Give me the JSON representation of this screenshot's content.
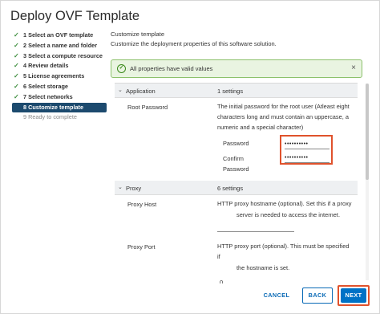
{
  "dialog": {
    "title": "Deploy OVF Template"
  },
  "steps": [
    {
      "label": "1 Select an OVF template",
      "state": "done"
    },
    {
      "label": "2 Select a name and folder",
      "state": "done"
    },
    {
      "label": "3 Select a compute resource",
      "state": "done"
    },
    {
      "label": "4 Review details",
      "state": "done"
    },
    {
      "label": "5 License agreements",
      "state": "done"
    },
    {
      "label": "6 Select storage",
      "state": "done"
    },
    {
      "label": "7 Select networks",
      "state": "done"
    },
    {
      "label": "8 Customize template",
      "state": "active"
    },
    {
      "label": "9 Ready to complete",
      "state": "pending"
    }
  ],
  "content": {
    "heading": "Customize template",
    "subheading": "Customize the deployment properties of this software solution."
  },
  "alert": {
    "text": "All properties have valid values",
    "close": "×"
  },
  "application": {
    "name": "Application",
    "count": "1 settings",
    "root_password_label": "Root Password",
    "root_password_desc": [
      "The initial password for the root user (Atleast eight",
      "characters long and must contain an uppercase, a",
      "numeric and a special character)"
    ],
    "password_label": "Password",
    "password_value": "••••••••••",
    "confirm_label_1": "Confirm",
    "confirm_label_2": "Password",
    "confirm_value": "••••••••••"
  },
  "proxy": {
    "name": "Proxy",
    "count": "6 settings",
    "host_label": "Proxy Host",
    "host_desc_1": "HTTP proxy hostname (optional). Set this if a proxy",
    "host_desc_2": "server is needed to access the internet.",
    "port_label": "Proxy Port",
    "port_desc_1": "HTTP proxy port (optional). This must be specified",
    "port_desc_2": "if",
    "port_desc_3": "the hostname is set.",
    "port_value": "0"
  },
  "footer": {
    "cancel": "CANCEL",
    "back": "BACK",
    "next": "NEXT"
  },
  "colors": {
    "accent": "#0072c6",
    "active_step": "#1c4a6e",
    "highlight": "#e0522c",
    "success": "#3c8a1c"
  }
}
